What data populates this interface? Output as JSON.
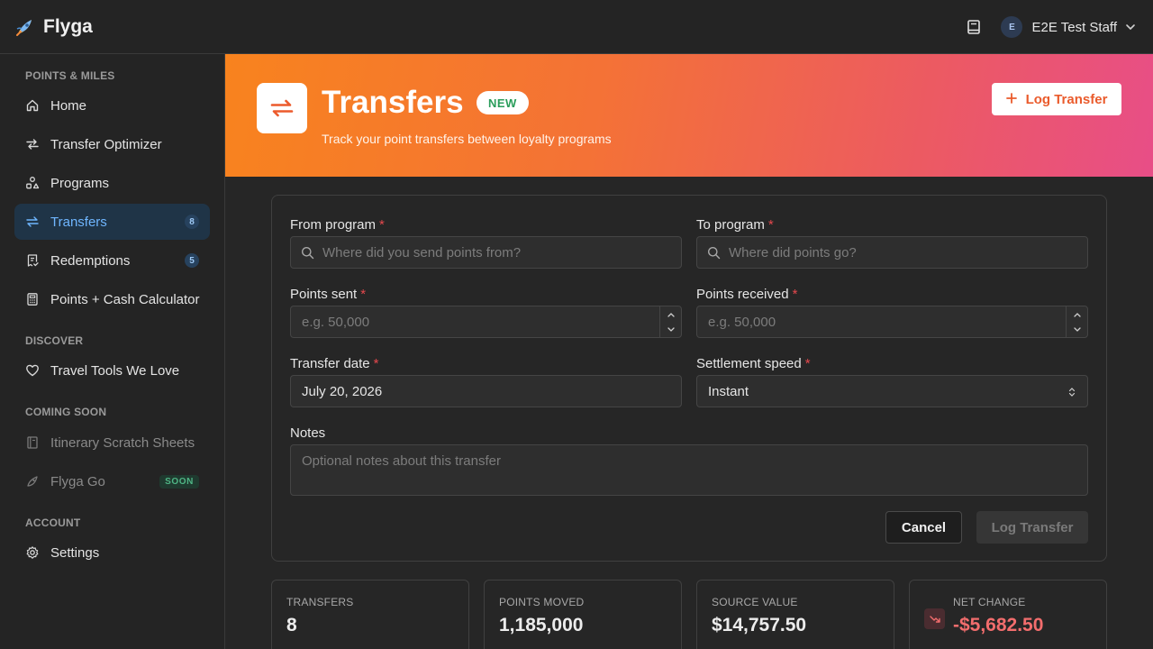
{
  "app": {
    "name": "Flyga"
  },
  "header": {
    "user_initial": "E",
    "user_name": "E2E Test Staff"
  },
  "sidebar": {
    "sections": [
      {
        "label": "POINTS & MILES"
      },
      {
        "label": "DISCOVER"
      },
      {
        "label": "COMING SOON"
      },
      {
        "label": "ACCOUNT"
      }
    ],
    "items": [
      {
        "label": "Home",
        "icon": "home-icon"
      },
      {
        "label": "Transfer Optimizer",
        "icon": "arrows-icon"
      },
      {
        "label": "Programs",
        "icon": "shapes-icon"
      },
      {
        "label": "Transfers",
        "icon": "transfer-icon",
        "badge": "8",
        "active": true
      },
      {
        "label": "Redemptions",
        "icon": "receipt-icon",
        "badge": "5"
      },
      {
        "label": "Points + Cash Calculator",
        "icon": "calculator-icon"
      },
      {
        "label": "Travel Tools We Love",
        "icon": "heart-icon"
      },
      {
        "label": "Itinerary Scratch Sheets",
        "icon": "notebook-icon"
      },
      {
        "label": "Flyga Go",
        "icon": "rocket-icon",
        "badge": "SOON"
      },
      {
        "label": "Settings",
        "icon": "gear-icon"
      }
    ]
  },
  "hero": {
    "title": "Transfers",
    "badge": "NEW",
    "subtitle": "Track your point transfers between loyalty programs",
    "button_label": "Log Transfer"
  },
  "form": {
    "from_program": {
      "label": "From program",
      "required": "*",
      "placeholder": "Where did you send points from?"
    },
    "to_program": {
      "label": "To program",
      "required": "*",
      "placeholder": "Where did points go?"
    },
    "points_sent": {
      "label": "Points sent",
      "required": "*",
      "placeholder": "e.g. 50,000"
    },
    "points_received": {
      "label": "Points received",
      "required": "*",
      "placeholder": "e.g. 50,000"
    },
    "transfer_date": {
      "label": "Transfer date",
      "required": "*",
      "value": "July 20, 2026"
    },
    "settlement_speed": {
      "label": "Settlement speed",
      "required": "*",
      "value": "Instant"
    },
    "notes": {
      "label": "Notes",
      "placeholder": "Optional notes about this transfer"
    },
    "cancel_label": "Cancel",
    "submit_label": "Log Transfer"
  },
  "stats": [
    {
      "label": "TRANSFERS",
      "value": "8"
    },
    {
      "label": "POINTS MOVED",
      "value": "1,185,000"
    },
    {
      "label": "SOURCE VALUE",
      "value": "$14,757.50"
    },
    {
      "label": "NET CHANGE",
      "value": "-$5,682.50"
    }
  ],
  "colors": {
    "accent": "#6fb6ff",
    "hero_gradient_start": "#f8831e",
    "hero_gradient_end": "#e84e87",
    "negative": "#f26d6d",
    "required": "#e5484d"
  }
}
